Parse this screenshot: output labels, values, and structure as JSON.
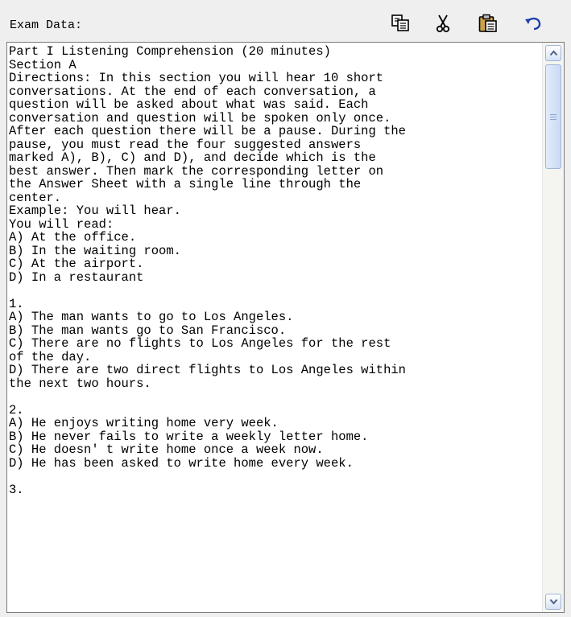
{
  "header": {
    "label": "Exam Data:"
  },
  "toolbar": {
    "copy_icon": "copy-icon",
    "cut_icon": "cut-icon",
    "paste_icon": "paste-icon",
    "undo_icon": "undo-icon"
  },
  "exam_text": "Part I Listening Comprehension (20 minutes)\nSection A\nDirections: In this section you will hear 10 short\nconversations. At the end of each conversation, a\nquestion will be asked about what was said. Each\nconversation and question will be spoken only once.\nAfter each question there will be a pause. During the\npause, you must read the four suggested answers\nmarked A), B), C) and D), and decide which is the\nbest answer. Then mark the corresponding letter on\nthe Answer Sheet with a single line through the\ncenter.\nExample: You will hear.\nYou will read:\nA) At the office.\nB) In the waiting room.\nC) At the airport.\nD) In a restaurant\n\n1.\nA) The man wants to go to Los Angeles.\nB) The man wants go to San Francisco.\nC) There are no flights to Los Angeles for the rest\nof the day.\nD) There are two direct flights to Los Angeles within\nthe next two hours.\n\n2.\nA) He enjoys writing home very week.\nB) He never fails to write a weekly letter home.\nC) He doesn' t write home once a week now.\nD) He has been asked to write home every week.\n\n3.",
  "scrollbar": {
    "up_icon": "chevron-up-icon",
    "down_icon": "chevron-down-icon",
    "position": 0.0
  }
}
